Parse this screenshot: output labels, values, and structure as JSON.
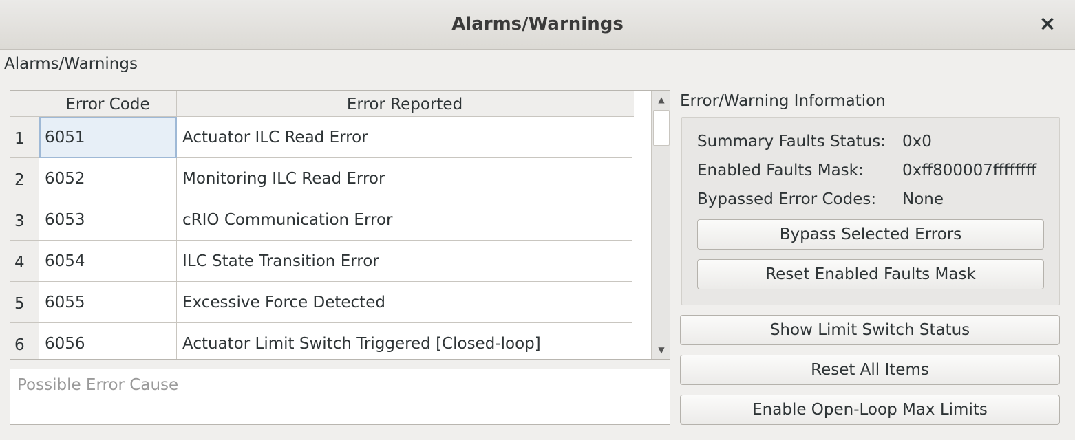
{
  "window": {
    "title": "Alarms/Warnings",
    "close_glyph": "×"
  },
  "group_label": "Alarms/Warnings",
  "table": {
    "headers": {
      "code": "Error Code",
      "reported": "Error Reported"
    },
    "rows": [
      {
        "num": "1",
        "code": "6051",
        "reported": "Actuator ILC Read Error"
      },
      {
        "num": "2",
        "code": "6052",
        "reported": "Monitoring ILC Read Error"
      },
      {
        "num": "3",
        "code": "6053",
        "reported": "cRIO Communication Error"
      },
      {
        "num": "4",
        "code": "6054",
        "reported": "ILC State Transition Error"
      },
      {
        "num": "5",
        "code": "6055",
        "reported": "Excessive Force Detected"
      },
      {
        "num": "6",
        "code": "6056",
        "reported": "Actuator Limit Switch Triggered [Closed-loop]"
      }
    ]
  },
  "cause": {
    "placeholder": "Possible Error Cause"
  },
  "info": {
    "title": "Error/Warning Information",
    "summary_label": "Summary Faults Status:",
    "summary_value": "0x0",
    "mask_label": "Enabled Faults Mask:",
    "mask_value": "0xff800007ffffffff",
    "bypassed_label": "Bypassed Error Codes:",
    "bypassed_value": "None",
    "bypass_button": "Bypass Selected Errors",
    "reset_mask_button": "Reset Enabled Faults Mask"
  },
  "buttons": {
    "limit_switch": "Show Limit Switch Status",
    "reset_all": "Reset All Items",
    "open_loop": "Enable Open-Loop Max Limits"
  },
  "icons": {
    "scroll_up": "up-arrow-icon",
    "scroll_down": "down-arrow-icon"
  },
  "colors": {
    "selection": "#e7eff7",
    "titlebar": "#dcdad5"
  }
}
